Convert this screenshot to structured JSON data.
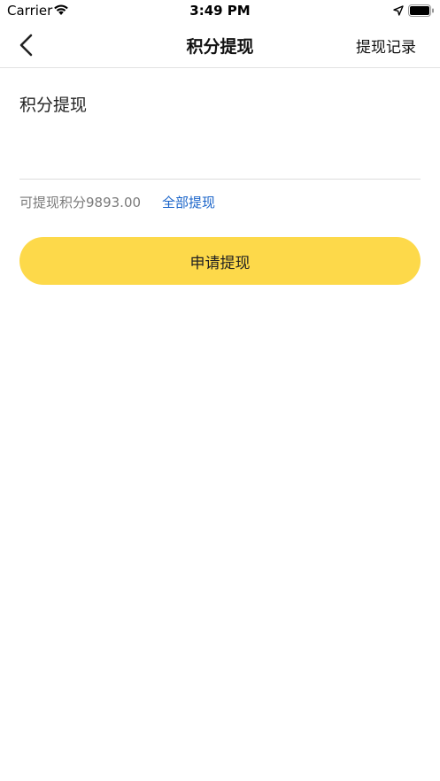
{
  "status_bar": {
    "carrier": "Carrier",
    "time": "3:49 PM",
    "icons": [
      "wifi-icon",
      "location-arrow-icon",
      "battery-icon"
    ]
  },
  "nav": {
    "title": "积分提现",
    "right_link": "提现记录",
    "back_icon": "chevron-left-icon"
  },
  "form": {
    "section_title": "积分提现",
    "amount_value": "",
    "available_text": "可提现积分9893.00",
    "withdraw_all_label": "全部提现",
    "submit_label": "申请提现"
  },
  "colors": {
    "accent_button": "#fdd94a",
    "link": "#1a64c9"
  }
}
